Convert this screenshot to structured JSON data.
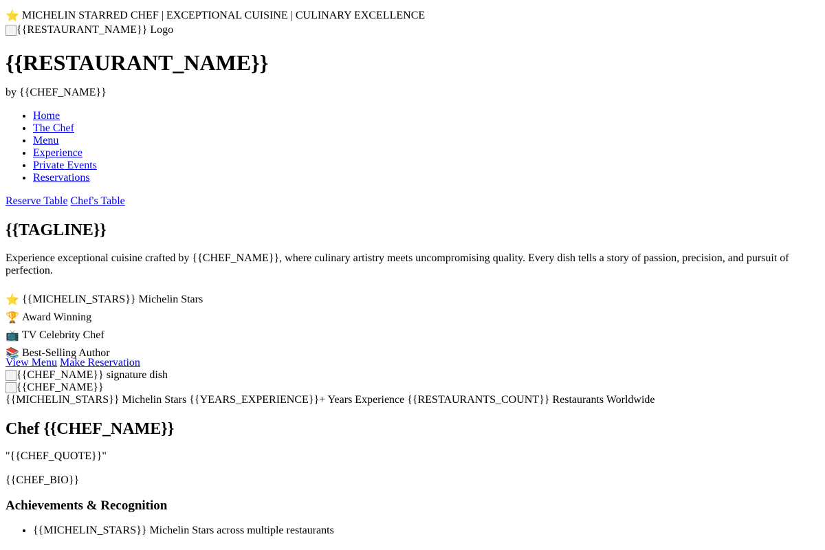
{
  "topbar": {
    "icon": "star-emoji",
    "text": "MICHELIN STARRED CHEF | EXCEPTIONAL CUISINE | CULINARY EXCELLENCE"
  },
  "logo": {
    "alt": "{{RESTAURANT_NAME}} Logo"
  },
  "restaurant_name": "{{RESTAURANT_NAME}}",
  "byline": "by {{CHEF_NAME}}",
  "nav": [
    {
      "label": "Home"
    },
    {
      "label": "The Chef"
    },
    {
      "label": "Menu"
    },
    {
      "label": "Experience"
    },
    {
      "label": "Private Events"
    },
    {
      "label": "Reservations"
    }
  ],
  "cta": {
    "reserve_table": "Reserve Table",
    "chefs_table": "Chef's Table"
  },
  "hero": {
    "tagline": "{{TAGLINE}}",
    "description": "Experience exceptional cuisine crafted by {{CHEF_NAME}}, where culinary artistry meets uncompromising quality. Every dish tells a story of passion, precision, and pursuit of perfection.",
    "badges": [
      {
        "icon": "star-emoji",
        "label": "{{MICHELIN_STARS}} Michelin Stars"
      },
      {
        "icon": "trophy-emoji",
        "label": "Award Winning"
      },
      {
        "icon": "tv-emoji",
        "label": "TV Celebrity Chef"
      },
      {
        "icon": "books-emoji",
        "label": "Best-Selling Author"
      }
    ],
    "actions": {
      "view_menu": "View Menu",
      "make_reservation": "Make Reservation"
    },
    "signature_dish_alt": "{{CHEF_NAME}} signature dish",
    "chef_image_alt": "{{CHEF_NAME}}",
    "stats_line": "{{MICHELIN_STARS}} Michelin Stars {{YEARS_EXPERIENCE}}+ Years Experience {{RESTAURANTS_COUNT}} Restaurants Worldwide"
  },
  "chef": {
    "title": "Chef {{CHEF_NAME}}",
    "quote": "\"{{CHEF_QUOTE}}\"",
    "bio": "{{CHEF_BIO}}",
    "achievements_heading": "Achievements & Recognition",
    "achievements": [
      {
        "label": "{{MICHELIN_STARS}} Michelin Stars across multiple restaurants"
      }
    ]
  }
}
